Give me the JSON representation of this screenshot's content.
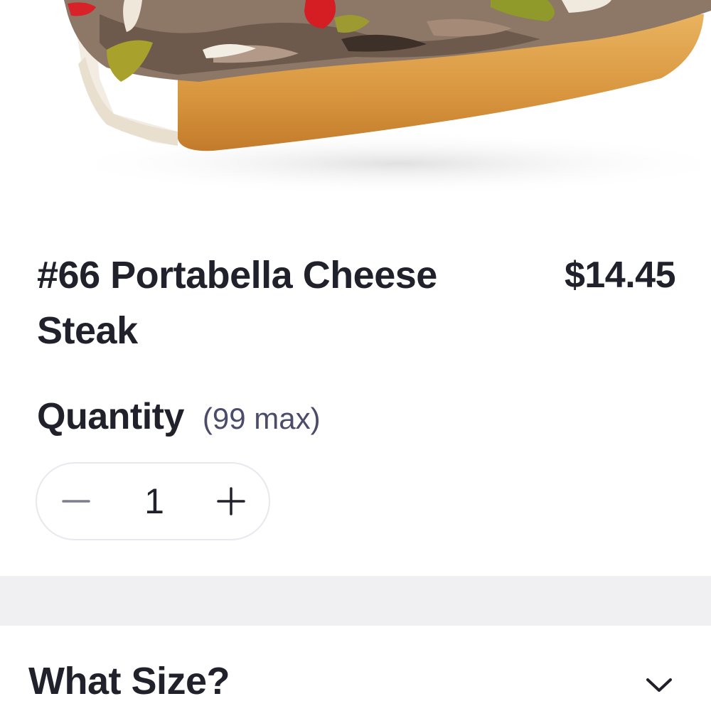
{
  "product": {
    "image_icon": "cheesesteak-photo",
    "title": "#66 Portabella Cheese Steak",
    "price": "$14.45"
  },
  "quantity": {
    "label": "Quantity",
    "max_note": "(99 max)",
    "value": "1",
    "minus_icon": "minus-icon",
    "plus_icon": "plus-icon"
  },
  "options": {
    "size_heading": "What Size?",
    "expand_icon": "chevron-down-icon"
  },
  "colors": {
    "text": "#20212b",
    "muted": "#4b4c6a",
    "band": "#f0f0f3",
    "border": "#e8e8ee"
  }
}
